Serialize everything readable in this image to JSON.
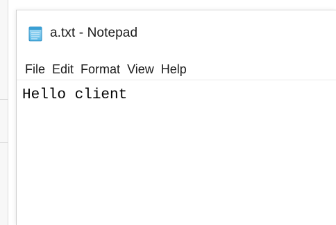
{
  "window": {
    "title": "a.txt - Notepad",
    "icon": "notepad-icon"
  },
  "menubar": {
    "items": [
      {
        "label": "File"
      },
      {
        "label": "Edit"
      },
      {
        "label": "Format"
      },
      {
        "label": "View"
      },
      {
        "label": "Help"
      }
    ]
  },
  "editor": {
    "content": "Hello client"
  }
}
